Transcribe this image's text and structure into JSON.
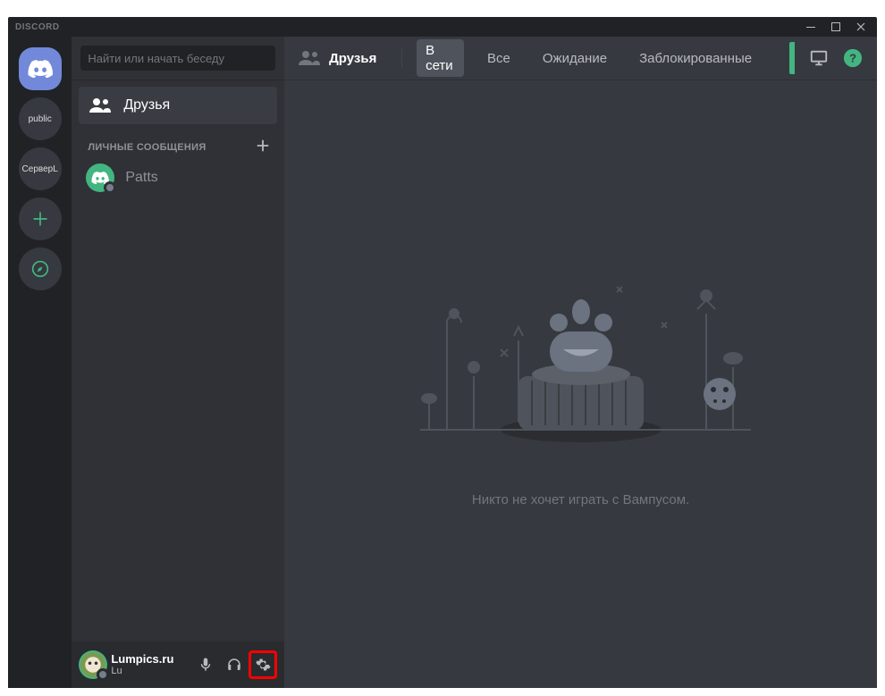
{
  "titlebar": {
    "logo": "DISCORD"
  },
  "servers": {
    "home": "home",
    "items": [
      {
        "label": "public"
      },
      {
        "label": "СерверL"
      }
    ]
  },
  "sidebar": {
    "search_placeholder": "Найти или начать беседу",
    "friends_label": "Друзья",
    "dm_header": "ЛИЧНЫЕ СООБЩЕНИЯ",
    "dms": [
      {
        "name": "Patts"
      }
    ]
  },
  "user": {
    "name": "Lumpics.ru",
    "sub": "Lu"
  },
  "topbar": {
    "title": "Друзья",
    "tabs": [
      {
        "label": "В сети",
        "active": true
      },
      {
        "label": "Все",
        "active": false
      },
      {
        "label": "Ожидание",
        "active": false
      },
      {
        "label": "Заблокированные",
        "active": false
      }
    ]
  },
  "main": {
    "empty_text": "Никто не хочет играть с Вампусом."
  }
}
